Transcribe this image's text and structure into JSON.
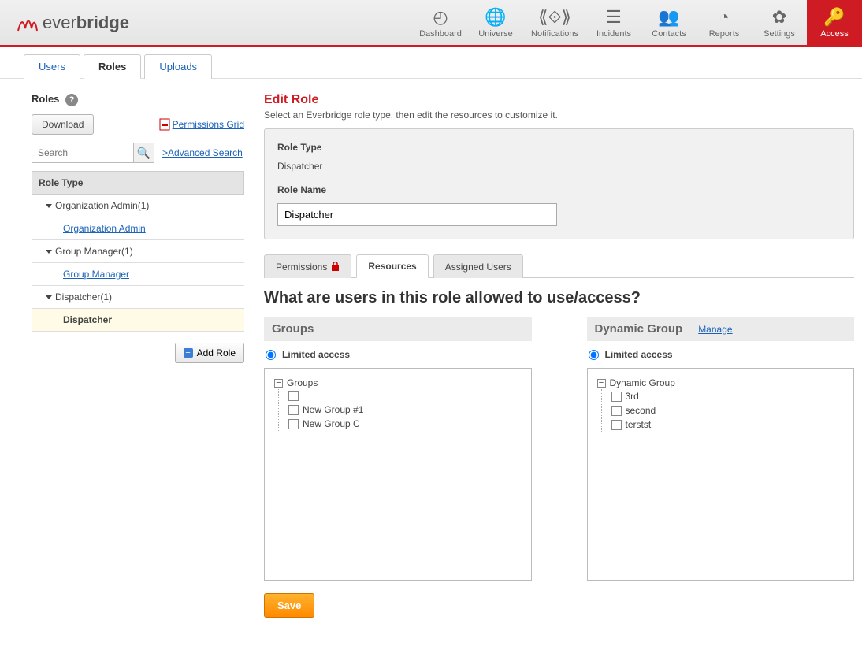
{
  "logo": {
    "thin": "ever",
    "bold": "bridge"
  },
  "nav": [
    {
      "label": "Dashboard",
      "icon": "◴"
    },
    {
      "label": "Universe",
      "icon": "🌐"
    },
    {
      "label": "Notifications",
      "icon": "⟪⟐⟫"
    },
    {
      "label": "Incidents",
      "icon": "☰"
    },
    {
      "label": "Contacts",
      "icon": "👥"
    },
    {
      "label": "Reports",
      "icon": "◔"
    },
    {
      "label": "Settings",
      "icon": "✿"
    },
    {
      "label": "Access",
      "icon": "🔑"
    }
  ],
  "subtabs": {
    "users": "Users",
    "roles": "Roles",
    "uploads": "Uploads"
  },
  "left": {
    "title": "Roles",
    "download": "Download",
    "permissions_grid": "Permissions Grid",
    "search_placeholder": "Search",
    "advanced_search": ">Advanced Search",
    "tree_header": "Role Type",
    "org_admin_parent": "Organization Admin(1)",
    "org_admin_child": "Organization Admin",
    "group_mgr_parent": "Group Manager(1)",
    "group_mgr_child": "Group Manager",
    "dispatcher_parent": "Dispatcher(1)",
    "dispatcher_child": "Dispatcher",
    "add_role": "Add Role"
  },
  "edit": {
    "title": "Edit Role",
    "desc": "Select an Everbridge role type, then edit the resources to customize it.",
    "role_type_label": "Role Type",
    "role_type_value": "Dispatcher",
    "role_name_label": "Role Name",
    "role_name_value": "Dispatcher"
  },
  "mid_tabs": {
    "permissions": "Permissions",
    "resources": "Resources",
    "assigned": "Assigned Users"
  },
  "question": "What are users in this role allowed to use/access?",
  "groups": {
    "header": "Groups",
    "limited": "Limited access",
    "root": "Groups",
    "items": [
      "",
      "New Group #1",
      "New Group C"
    ]
  },
  "dynamic": {
    "header": "Dynamic Group",
    "manage": "Manage",
    "limited": "Limited access",
    "root": "Dynamic Group",
    "items": [
      "3rd",
      "second",
      "terstst"
    ]
  },
  "save": "Save"
}
